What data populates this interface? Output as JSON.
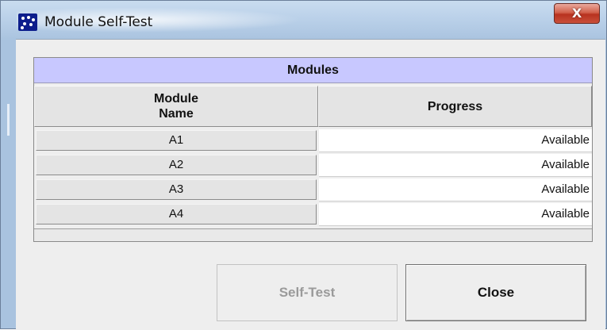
{
  "window": {
    "title": "Module Self-Test",
    "close_glyph": "X",
    "icon": "app-dots-icon"
  },
  "table": {
    "group_header": "Modules",
    "columns": {
      "name_line1": "Module",
      "name_line2": "Name",
      "progress": "Progress"
    },
    "rows": [
      {
        "name": "A1",
        "progress": "Available"
      },
      {
        "name": "A2",
        "progress": "Available"
      },
      {
        "name": "A3",
        "progress": "Available"
      },
      {
        "name": "A4",
        "progress": "Available"
      }
    ]
  },
  "buttons": {
    "self_test": "Self-Test",
    "close": "Close"
  },
  "colors": {
    "group_header_bg": "#c8c8ff",
    "app_icon": "#0d1e8c",
    "close_button": "#c9503b"
  }
}
